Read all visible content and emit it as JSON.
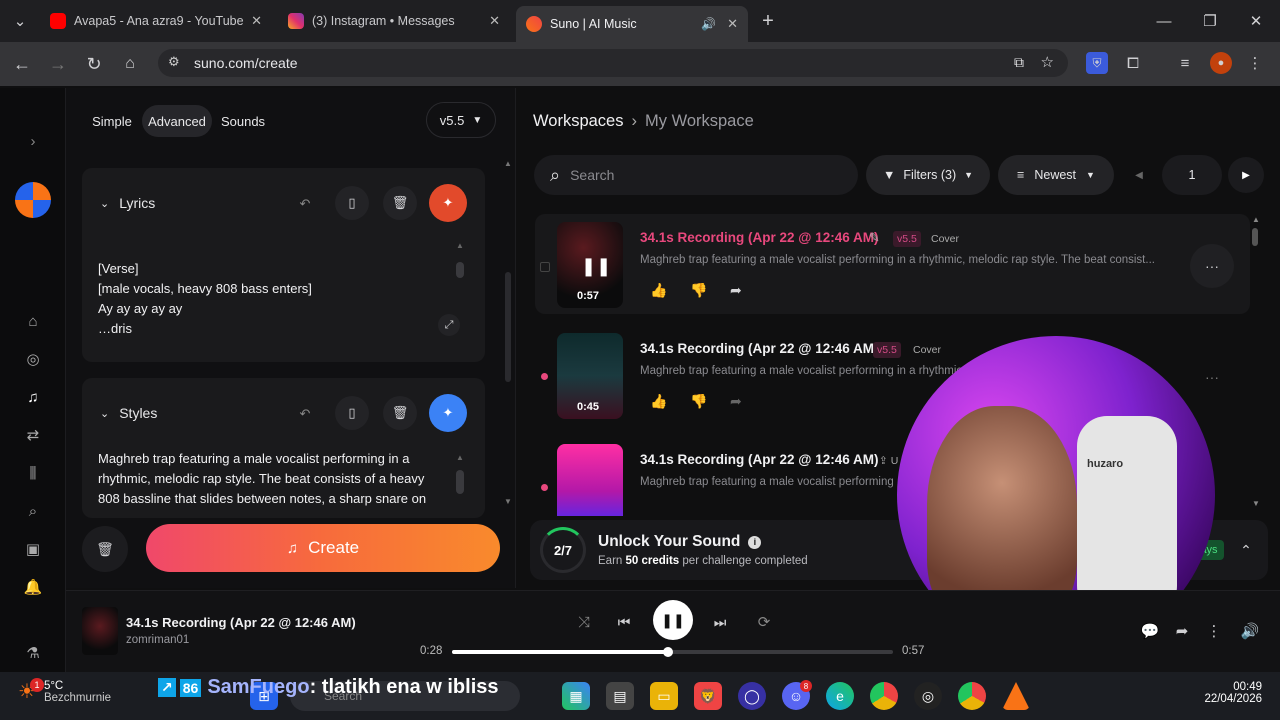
{
  "browser": {
    "tabs": [
      {
        "title": "Avapa5 - Ana azra9 - YouTube"
      },
      {
        "title": "(3) Instagram • Messages"
      },
      {
        "title": "Suno | AI Music"
      }
    ],
    "url": "suno.com/create"
  },
  "create_panel": {
    "modes": [
      "Simple",
      "Advanced",
      "Sounds"
    ],
    "model": "v5.5",
    "lyrics": {
      "heading": "Lyrics",
      "lines": [
        "[Verse]",
        "[male vocals, heavy 808 bass enters]",
        "Ay ay ay ay ay",
        "…dris"
      ]
    },
    "styles": {
      "heading": "Styles",
      "text": "Maghreb trap featuring a male vocalist performing in a rhythmic, melodic rap style. The beat consists of a heavy 808 bassline that slides between notes, a sharp snare on"
    },
    "create_label": "Create"
  },
  "workspace": {
    "breadcrumb": [
      "Workspaces",
      "My Workspace"
    ],
    "search_placeholder": "Search",
    "filters_label": "Filters (3)",
    "sort_label": "Newest",
    "page": "1",
    "songs": [
      {
        "title": "34.1s Recording (Apr 22 @ 12:46 AM)",
        "version": "v5.5",
        "tag": "Cover",
        "desc": "Maghreb trap featuring a male vocalist performing in a rhythmic, melodic rap style. The beat consist...",
        "duration": "0:57"
      },
      {
        "title": "34.1s Recording (Apr 22 @ 12:46 AM)",
        "version": "v5.5",
        "tag": "Cover",
        "desc": "Maghreb trap featuring a male vocalist performing in a rhythmic",
        "duration": "0:45"
      },
      {
        "title": "34.1s Recording (Apr 22 @ 12:46 AM)",
        "version": "",
        "tag": "U",
        "desc": "Maghreb trap featuring a male vocalist performing",
        "duration": ""
      }
    ],
    "unlock": {
      "progress": "2/7",
      "title": "Unlock Your Sound",
      "subtitle_pre": "Earn ",
      "subtitle_bold": "50 credits",
      "subtitle_post": " per challenge completed",
      "badge": "ays"
    }
  },
  "player": {
    "title": "34.1s Recording (Apr 22 @ 12:46 AM)",
    "artist": "zomriman01",
    "elapsed": "0:28",
    "total": "0:57",
    "progress_fraction": 0.49
  },
  "overlay": {
    "chat_user": "SamFuego",
    "chat_msg": ": tlatikh ena w ibliss",
    "webcam_text": "huzaro"
  },
  "taskbar": {
    "temp": "5°C",
    "location": "Bezchmurnie",
    "search_placeholder": "Search",
    "time": "00:49",
    "date": "22/04/2026",
    "notif": "1",
    "discord_badge": "8"
  },
  "colors": {
    "accent_pink": "#e83e8c",
    "create_gradient": [
      "#f0486a",
      "#f98a2c"
    ],
    "blue": "#3b82f6"
  }
}
